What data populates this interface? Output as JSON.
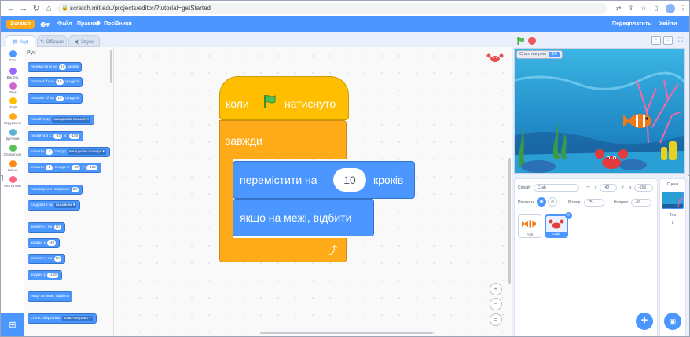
{
  "browser": {
    "url": "scratch.mit.edu/projects/editor/?tutorial=getStarted"
  },
  "menubar": {
    "logo": "Scratch",
    "items": [
      "Файл",
      "Правка",
      "Посібники"
    ],
    "right": [
      "Передплатить",
      "Увійти"
    ]
  },
  "tabs": [
    "Код",
    "Образи",
    "Звуки"
  ],
  "categories": [
    {
      "label": "Рух",
      "color": "#4c97ff"
    },
    {
      "label": "Вигляд",
      "color": "#9966ff"
    },
    {
      "label": "Звук",
      "color": "#cf63cf"
    },
    {
      "label": "Події",
      "color": "#ffbf00"
    },
    {
      "label": "Керування",
      "color": "#ffab19"
    },
    {
      "label": "Датчики",
      "color": "#5cb1d6"
    },
    {
      "label": "Оператори",
      "color": "#59c059"
    },
    {
      "label": "Змінні",
      "color": "#ff8c1a"
    },
    {
      "label": "Мої Блоки",
      "color": "#ff6680"
    }
  ],
  "palette": {
    "title": "Рух",
    "blocks": [
      {
        "pre": "перемістити на",
        "num": "10",
        "post": "кроків"
      },
      {
        "pre": "поворот ↻ на",
        "num": "15",
        "post": "градусів"
      },
      {
        "pre": "поворот ↺ на",
        "num": "15",
        "post": "градусів"
      },
      {
        "pre": "перейти до",
        "dd": "випадкова позиція ▾",
        "post": ""
      },
      {
        "pre": "перейти в x:",
        "num": "-40",
        "mid": "y:",
        "num2": "-159",
        "post": ""
      },
      {
        "pre": "ковзати",
        "num": "1",
        "mid": "сек до",
        "dd": "випадкова позиція ▾",
        "post": ""
      },
      {
        "pre": "ковзати",
        "num": "1",
        "mid": "сек до x:",
        "num2": "-40",
        "mid2": "y:",
        "num3": "-159",
        "post": ""
      },
      {
        "pre": "повернути в напрямку",
        "num": "90",
        "post": ""
      },
      {
        "pre": "слідувати за",
        "dd": "вказівник ▾",
        "post": ""
      },
      {
        "pre": "змінити x на",
        "num": "10",
        "post": ""
      },
      {
        "pre": "задати x",
        "num": "-40",
        "post": ""
      },
      {
        "pre": "змінити y на",
        "num": "10",
        "post": ""
      },
      {
        "pre": "задати y",
        "num": "-159",
        "post": ""
      },
      {
        "pre": "якщо на межі, відбити",
        "post": ""
      },
      {
        "pre": "стиль обертання",
        "dd": "зліва-направо ▾",
        "post": ""
      }
    ]
  },
  "script": {
    "hat_pre": "коли",
    "hat_post": "натиснуто",
    "forever": "завжди",
    "move_pre": "перемістити на",
    "move_num": "10",
    "move_post": "кроків",
    "bounce": "якщо на межі, відбити"
  },
  "stage": {
    "monitor_label": "Crab: напрям",
    "monitor_value": "-90"
  },
  "sprite_info": {
    "sprite_label": "Спрайт",
    "sprite_name": "Crab",
    "x_label": "x",
    "x_value": "-40",
    "y_label": "y",
    "y_value": "-159",
    "show_label": "Показати",
    "size_label": "Розмір",
    "size_value": "75",
    "direction_label": "Напрям",
    "direction_value": "-90"
  },
  "sprites": [
    {
      "name": "Fish"
    },
    {
      "name": "Crab"
    }
  ],
  "scene": {
    "title": "Сцена",
    "backdrops_label": "Тло",
    "backdrops_count": "2"
  },
  "colors": {
    "motion": "#4c97ff",
    "events": "#ffbf00",
    "control": "#ffab19",
    "accent": "#4c97ff"
  }
}
